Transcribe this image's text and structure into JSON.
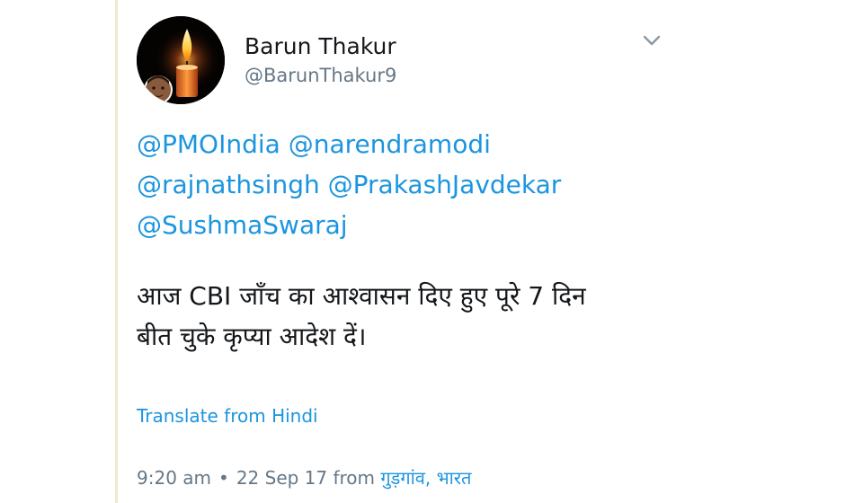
{
  "author": {
    "name": "Barun Thakur",
    "handle": "@BarunThakur9"
  },
  "tweet": {
    "mentions": {
      "line1": [
        "@PMOIndia",
        "@narendramodi"
      ],
      "line2": [
        "@rajnathsingh",
        "@PrakashJavdekar"
      ],
      "line3": [
        "@SushmaSwaraj"
      ]
    },
    "text_line1": "आज CBI जाँच का आश्वासन दिए हुए पूरे 7 दिन",
    "text_line2": "बीत चुके कृप्या आदेश दें।"
  },
  "translate_label": "Translate from Hindi",
  "meta": {
    "time": "9:20 am",
    "separator": "•",
    "date": "22 Sep 17",
    "from_label": "from",
    "location": "गुड़गांव, भारत"
  },
  "icons": {
    "more": "chevron-down-icon",
    "avatar": "candle-photo"
  },
  "colors": {
    "link": "#1b95e0",
    "secondary_text": "#657786",
    "primary_text": "#14171a",
    "thread_line": "#f0e9cf"
  }
}
